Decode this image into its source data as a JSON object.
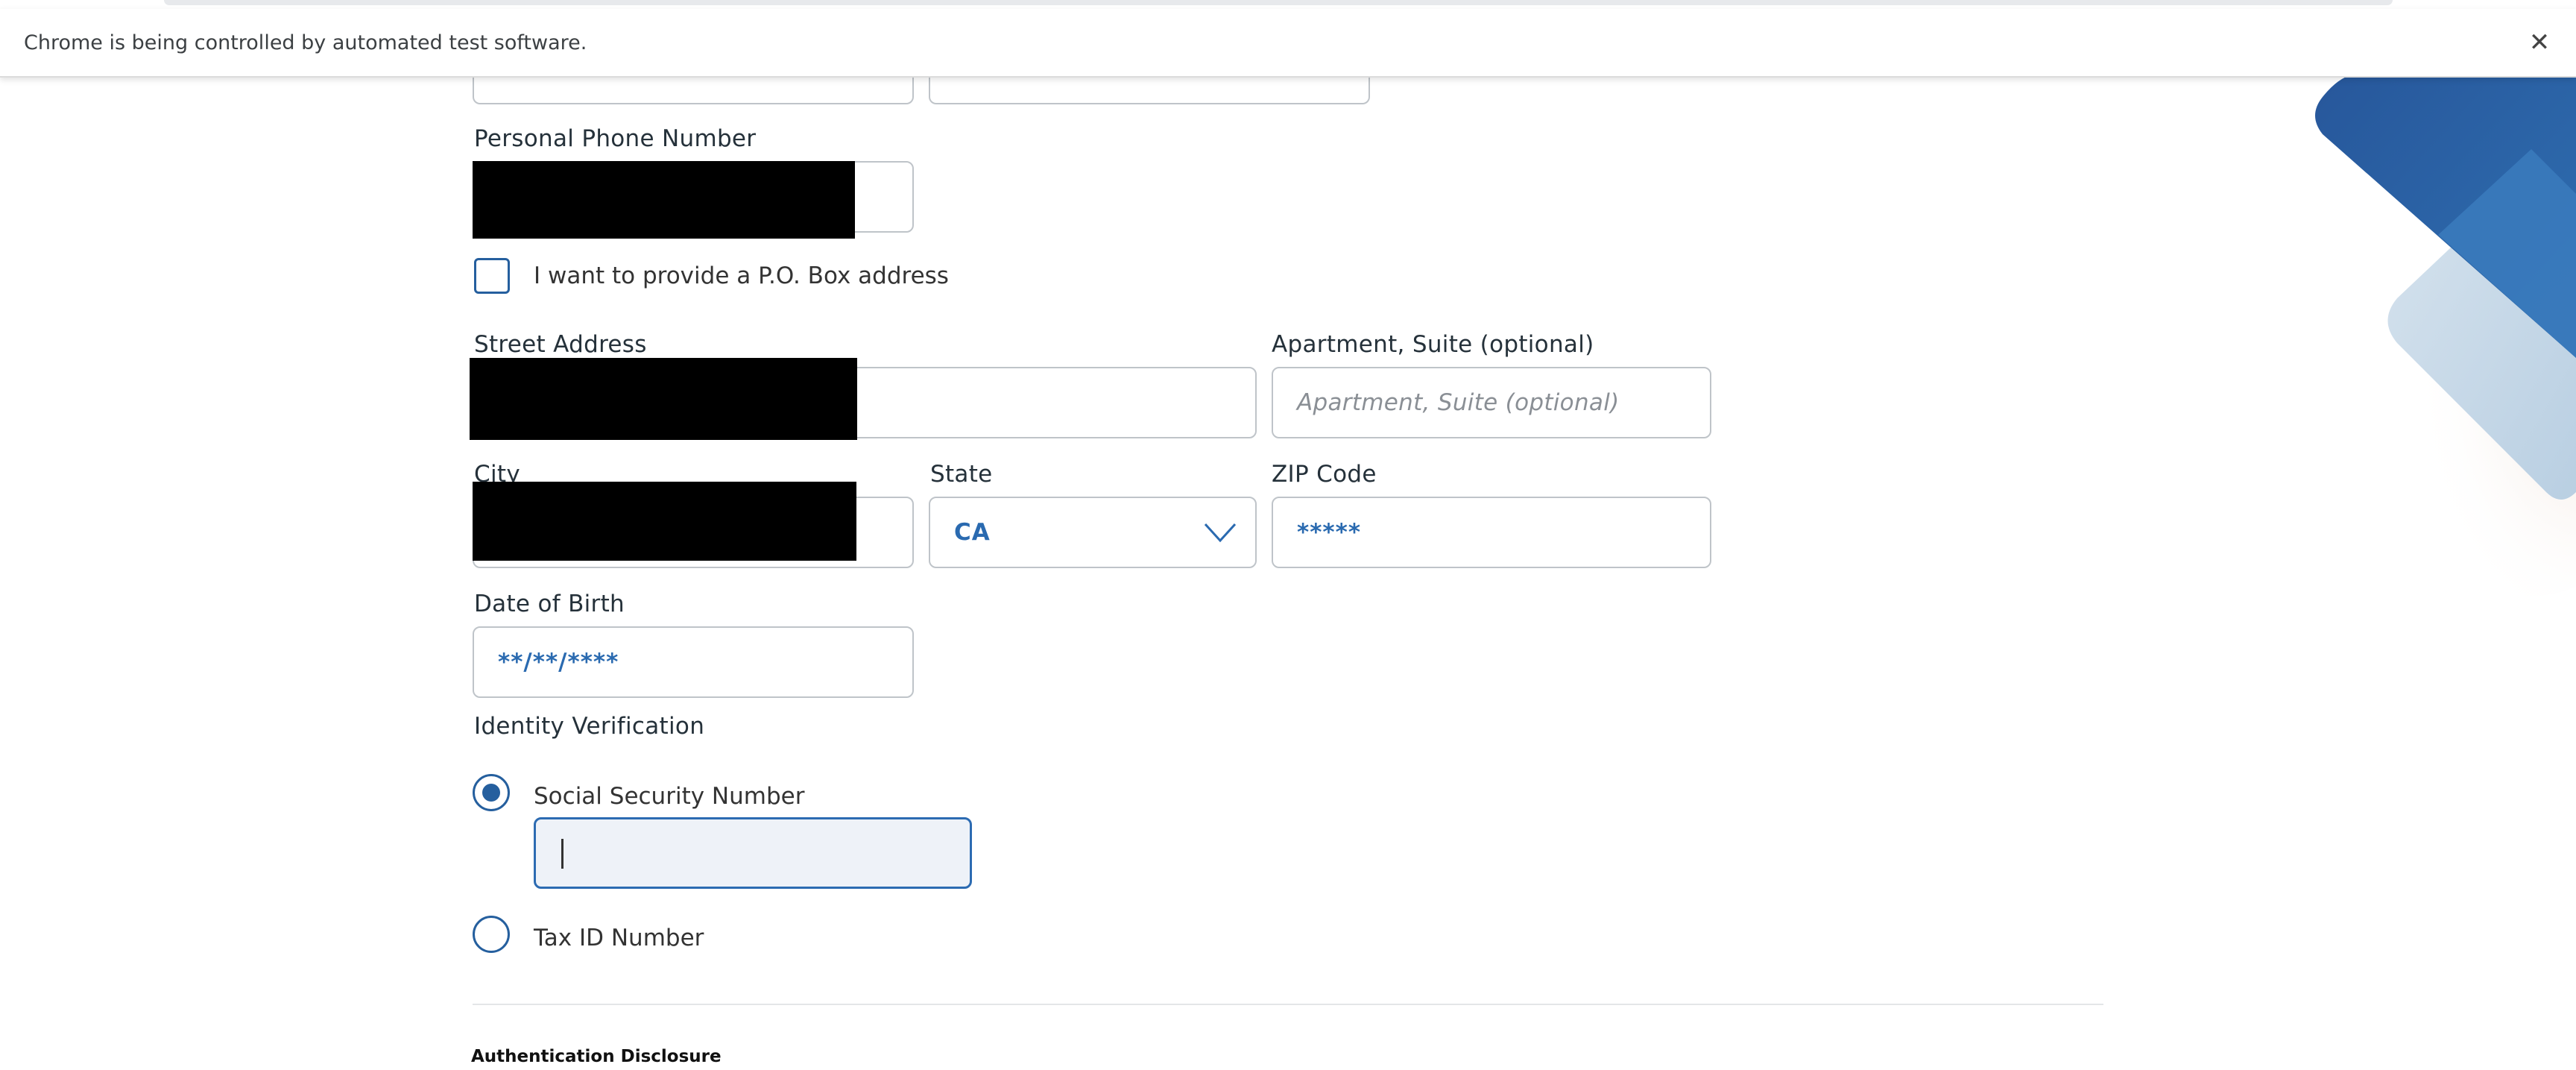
{
  "browser": {
    "infobar_text": "Chrome is being controlled by automated test software.",
    "close_symbol": "✕"
  },
  "form": {
    "phone": {
      "label": "Personal Phone Number"
    },
    "po_box": {
      "label": "I want to provide a P.O. Box address",
      "checked": false
    },
    "street": {
      "label": "Street Address"
    },
    "apartment": {
      "label": "Apartment, Suite (optional)",
      "placeholder": "Apartment, Suite (optional)"
    },
    "city": {
      "label": "City"
    },
    "state": {
      "label": "State",
      "value": "CA"
    },
    "zip": {
      "label": "ZIP Code",
      "value": "*****"
    },
    "dob": {
      "label": "Date of Birth",
      "value": "**/**/****"
    },
    "identity": {
      "label": "Identity Verification",
      "ssn_label": "Social Security Number",
      "tax_label": "Tax ID Number",
      "selected": "ssn"
    }
  },
  "disclosure": {
    "title": "Authentication Disclosure"
  },
  "colors": {
    "accent": "#255f9e",
    "value_text": "#2a6ab0",
    "focused_bg": "#eef2f8"
  }
}
